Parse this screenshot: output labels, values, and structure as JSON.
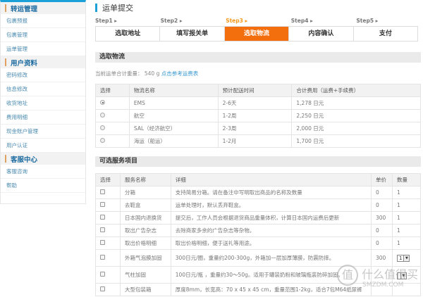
{
  "sidebar": {
    "sections": [
      {
        "title": "转运管理",
        "items": [
          "包裹预报",
          "包裹管理",
          "运单管理"
        ]
      },
      {
        "title": "用户资料",
        "items": [
          "密码修改",
          "信息修改",
          "收货地址",
          "费用明细",
          "现金账户管理",
          "用户认证"
        ]
      },
      {
        "title": "客服中心",
        "items": [
          "客服咨询",
          "帮助"
        ]
      }
    ]
  },
  "page_title": "运单提交",
  "steps": [
    {
      "label": "Step1",
      "name": "选取地址"
    },
    {
      "label": "Step2",
      "name": "填写报关单"
    },
    {
      "label": "Step3",
      "name": "选取物流"
    },
    {
      "label": "Step4",
      "name": "内容确认"
    },
    {
      "label": "Step5",
      "name": "支付"
    }
  ],
  "active_step": 2,
  "accent_color": "#f36f0e",
  "logistics": {
    "title": "选取物流",
    "weight_label": "当前运单合计重量：",
    "weight_value": "540 g",
    "rate_link": "点击参考运费表",
    "headers": [
      "选择",
      "物流名称",
      "预计配送时间",
      "合计费用（运费+手续费）"
    ],
    "rows": [
      {
        "selected": true,
        "name": "EMS",
        "time": "2-6天",
        "fee": "1,278 日元"
      },
      {
        "selected": false,
        "name": "航空",
        "time": "1-2周",
        "fee": "2,250 日元"
      },
      {
        "selected": false,
        "name": "SAL（经济航空）",
        "time": "2-3周",
        "fee": "2,000 日元"
      },
      {
        "selected": false,
        "name": "海运（船运）",
        "time": "1-2月",
        "fee": "1,700 日元"
      }
    ]
  },
  "services": {
    "title": "可选服务项目",
    "headers": [
      "选择",
      "服务名称",
      "详细",
      "单价",
      "数量"
    ],
    "rows": [
      {
        "name": "分箱",
        "detail": "支持简易分箱。请在备注中写明取出商品的名称及数量",
        "price": "0",
        "qty": "1"
      },
      {
        "name": "去鞋盒",
        "detail": "运单处理时，默认丢弃鞋盒。",
        "price": "0",
        "qty": "1"
      },
      {
        "name": "日本国内退换货",
        "detail": "提交后，工作人员会根据退货商品重量体积，计算日本国内运费后更新",
        "price": "300",
        "qty": "1"
      },
      {
        "name": "取出广告杂志",
        "detail": "去除商家多余的广告杂志等杂物。",
        "price": "0",
        "qty": "1"
      },
      {
        "name": "取出价格明细",
        "detail": "取出价格明细，便于送礼等用途。",
        "price": "0",
        "qty": "1"
      },
      {
        "name": "外箱气泡膜加固",
        "detail": "300日元/圈，重量约200-300g，外箱加一层加厚薄膜，防震防摔。",
        "price": "300",
        "qty": "1",
        "select": true
      },
      {
        "name": "气柱加固",
        "detail": "100日元/瓶 ，重量约30～50g。适用于罐装奶粉和玻璃瓶装防碎加固。",
        "price": "",
        "qty": "",
        "select": true
      },
      {
        "name": "大型包装箱",
        "detail": "厚度8mm，长宽高：70 x 45 x 45 cm，重量范围1-2kg，适合7包M64纸尿裤",
        "price": "",
        "qty": ""
      }
    ]
  },
  "watermark": {
    "logo": "值",
    "text": "什么值得买",
    "sub": "SMZDM.COM"
  }
}
